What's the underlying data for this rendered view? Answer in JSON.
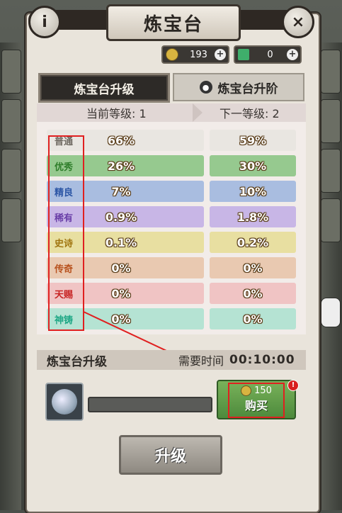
{
  "header": {
    "title": "炼宝台",
    "info_icon": "i",
    "close_icon": "×"
  },
  "currency": {
    "gold_value": "193",
    "ticket_value": "0",
    "plus": "+"
  },
  "tabs": [
    {
      "label": "炼宝台升级",
      "active": true
    },
    {
      "label": "炼宝台升阶",
      "active": false,
      "icon": "lock-icon"
    }
  ],
  "table": {
    "current_level_label": "当前等级: 1",
    "next_level_label": "下一等级: 2",
    "rows": [
      {
        "name": "普通",
        "current": "66%",
        "next": "59%",
        "color": "#e9e6e1",
        "name_color": "#6f6a62"
      },
      {
        "name": "优秀",
        "current": "26%",
        "next": "30%",
        "color": "#96c98f",
        "name_color": "#2e7d2a"
      },
      {
        "name": "精良",
        "current": "7%",
        "next": "10%",
        "color": "#a9bde0",
        "name_color": "#2d57a6"
      },
      {
        "name": "稀有",
        "current": "0.9%",
        "next": "1.8%",
        "color": "#c8b6e6",
        "name_color": "#6a3fa8"
      },
      {
        "name": "史诗",
        "current": "0.1%",
        "next": "0.2%",
        "color": "#e8dfa1",
        "name_color": "#a07510"
      },
      {
        "name": "传奇",
        "current": "0%",
        "next": "0%",
        "color": "#e9c9b1",
        "name_color": "#b8521e"
      },
      {
        "name": "天赐",
        "current": "0%",
        "next": "0%",
        "color": "#f0c4c4",
        "name_color": "#c72525"
      },
      {
        "name": "神铸",
        "current": "0%",
        "next": "0%",
        "color": "#b5e3d3",
        "name_color": "#1fa886"
      }
    ]
  },
  "upgrade": {
    "section_title": "炼宝台升级",
    "time_label": "需要时间",
    "time_value": "00:10:00",
    "progress": 0,
    "buy_cost": "150",
    "buy_label": "购买",
    "alert": "!",
    "upgrade_label": "升级"
  }
}
